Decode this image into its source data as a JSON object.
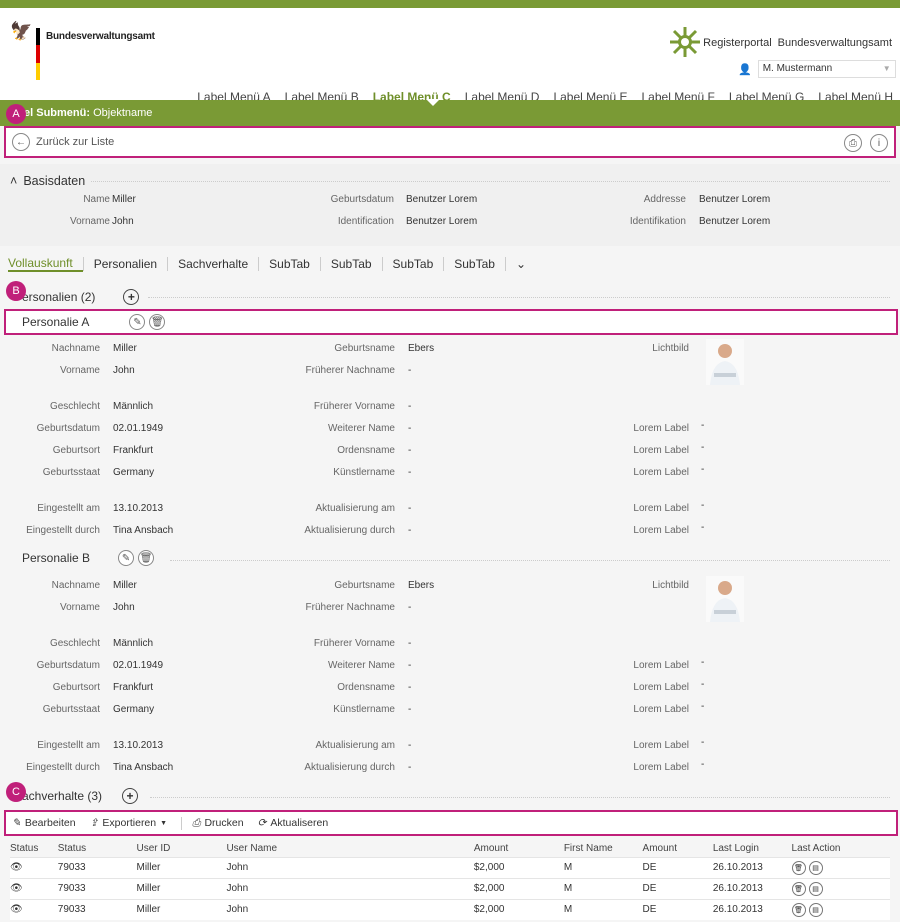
{
  "header": {
    "org": "Bundesverwaltungsamt",
    "portal": "Registerportal",
    "portal_org": "Bundesverwaltungsamt",
    "user": "M. Mustermann"
  },
  "menu": [
    "Label Menü A",
    "Label Menü B",
    "Label Menü C",
    "Label Menü  D",
    "Label Menü E",
    "Label Menü F",
    "Label Menü G",
    "Label Menü H"
  ],
  "submenu": {
    "label": "el Submenü:",
    "name": "Objektname"
  },
  "back": "Zurück zur Liste",
  "badges": {
    "a": "A",
    "b": "B",
    "c": "C"
  },
  "basis": {
    "title": "Basisdaten",
    "name_l": "Name",
    "name": "Miller",
    "vorname_l": "Vorname",
    "vorname": "John",
    "geb_l": "Geburtsdatum",
    "geb": "Benutzer Lorem",
    "id_l": "Identification",
    "id": "Benutzer Lorem",
    "addr_l": "Addresse",
    "addr": "Benutzer Lorem",
    "ident_l": "Identifikation",
    "ident": "Benutzer Lorem"
  },
  "tabs": [
    "Vollauskunft",
    "Personalien",
    "Sachverhalte",
    "SubTab",
    "SubTab",
    "SubTab",
    "SubTab"
  ],
  "personalien": {
    "title": "ersonalien (2)",
    "a": "Personalie A",
    "b": "Personalie B"
  },
  "fields": {
    "nachname_l": "Nachname",
    "nachname": "Miller",
    "vorname_l": "Vorname",
    "vorname": "John",
    "geschlecht_l": "Geschlecht",
    "geschlecht": "Männlich",
    "gebdat_l": "Geburtsdatum",
    "gebdat": "02.01.1949",
    "gebort_l": "Geburtsort",
    "gebort": "Frankfurt",
    "gebstaat_l": "Geburtsstaat",
    "gebstaat": "Germany",
    "eing_am_l": "Eingestellt am",
    "eing_am": "13.10.2013",
    "eing_durch_l": "Eingestellt durch",
    "eing_durch": "Tina Ansbach",
    "gebname_l": "Geburtsname",
    "gebname": "Ebers",
    "frnach_l": "Früherer Nachname",
    "frvor_l": "Früherer Vorname",
    "weiter_l": "Weiterer Name",
    "orden_l": "Ordensname",
    "kuenst_l": "Künstlername",
    "akt_am_l": "Aktualisierung am",
    "akt_durch_l": "Aktualisierung durch",
    "dash": "-",
    "lichtbild_l": "Lichtbild",
    "lorem_l": "Lorem Label"
  },
  "sach": {
    "title": "achverhalte (3)"
  },
  "toolbar": {
    "edit": "Bearbeiten",
    "export": "Exportieren",
    "print": "Drucken",
    "refresh": "Aktualiseren"
  },
  "table": {
    "headers": [
      "Status",
      "Status",
      "User ID",
      "User Name",
      "Amount",
      "First Name",
      "Amount",
      "Last Login",
      "Last Action"
    ],
    "rows": [
      [
        "79033",
        "Miller",
        "John",
        "$2,000",
        "M",
        "DE",
        "26.10.2013"
      ],
      [
        "79033",
        "Miller",
        "John",
        "$2,000",
        "M",
        "DE",
        "26.10.2013"
      ],
      [
        "79033",
        "Miller",
        "John",
        "$2,000",
        "M",
        "DE",
        "26.10.2013"
      ]
    ]
  },
  "colors": {
    "green": "#7a9a35",
    "magenta": "#c0207a"
  }
}
